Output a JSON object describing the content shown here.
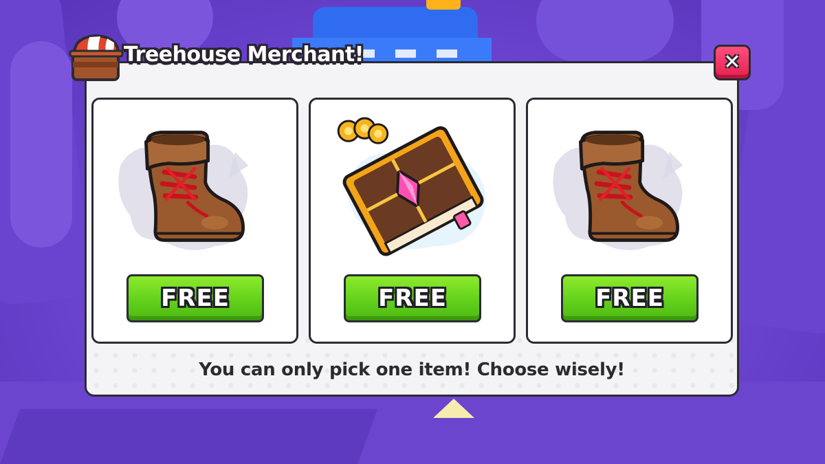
{
  "dialog": {
    "title": "Treehouse Merchant!",
    "close_label": "✕",
    "hint": "You can only pick one item! Choose wisely!"
  },
  "items": [
    {
      "name": "boot-item",
      "icon": "boot-icon",
      "price_label": "FREE"
    },
    {
      "name": "book-item",
      "icon": "enchant-book-icon",
      "price_label": "FREE"
    },
    {
      "name": "boot-item",
      "icon": "boot-icon",
      "price_label": "FREE"
    }
  ],
  "colors": {
    "panel_bg": "#f4f4f6",
    "free_button": "#5fcf1a",
    "close_button": "#e5204f",
    "background": "#6f47d4"
  }
}
